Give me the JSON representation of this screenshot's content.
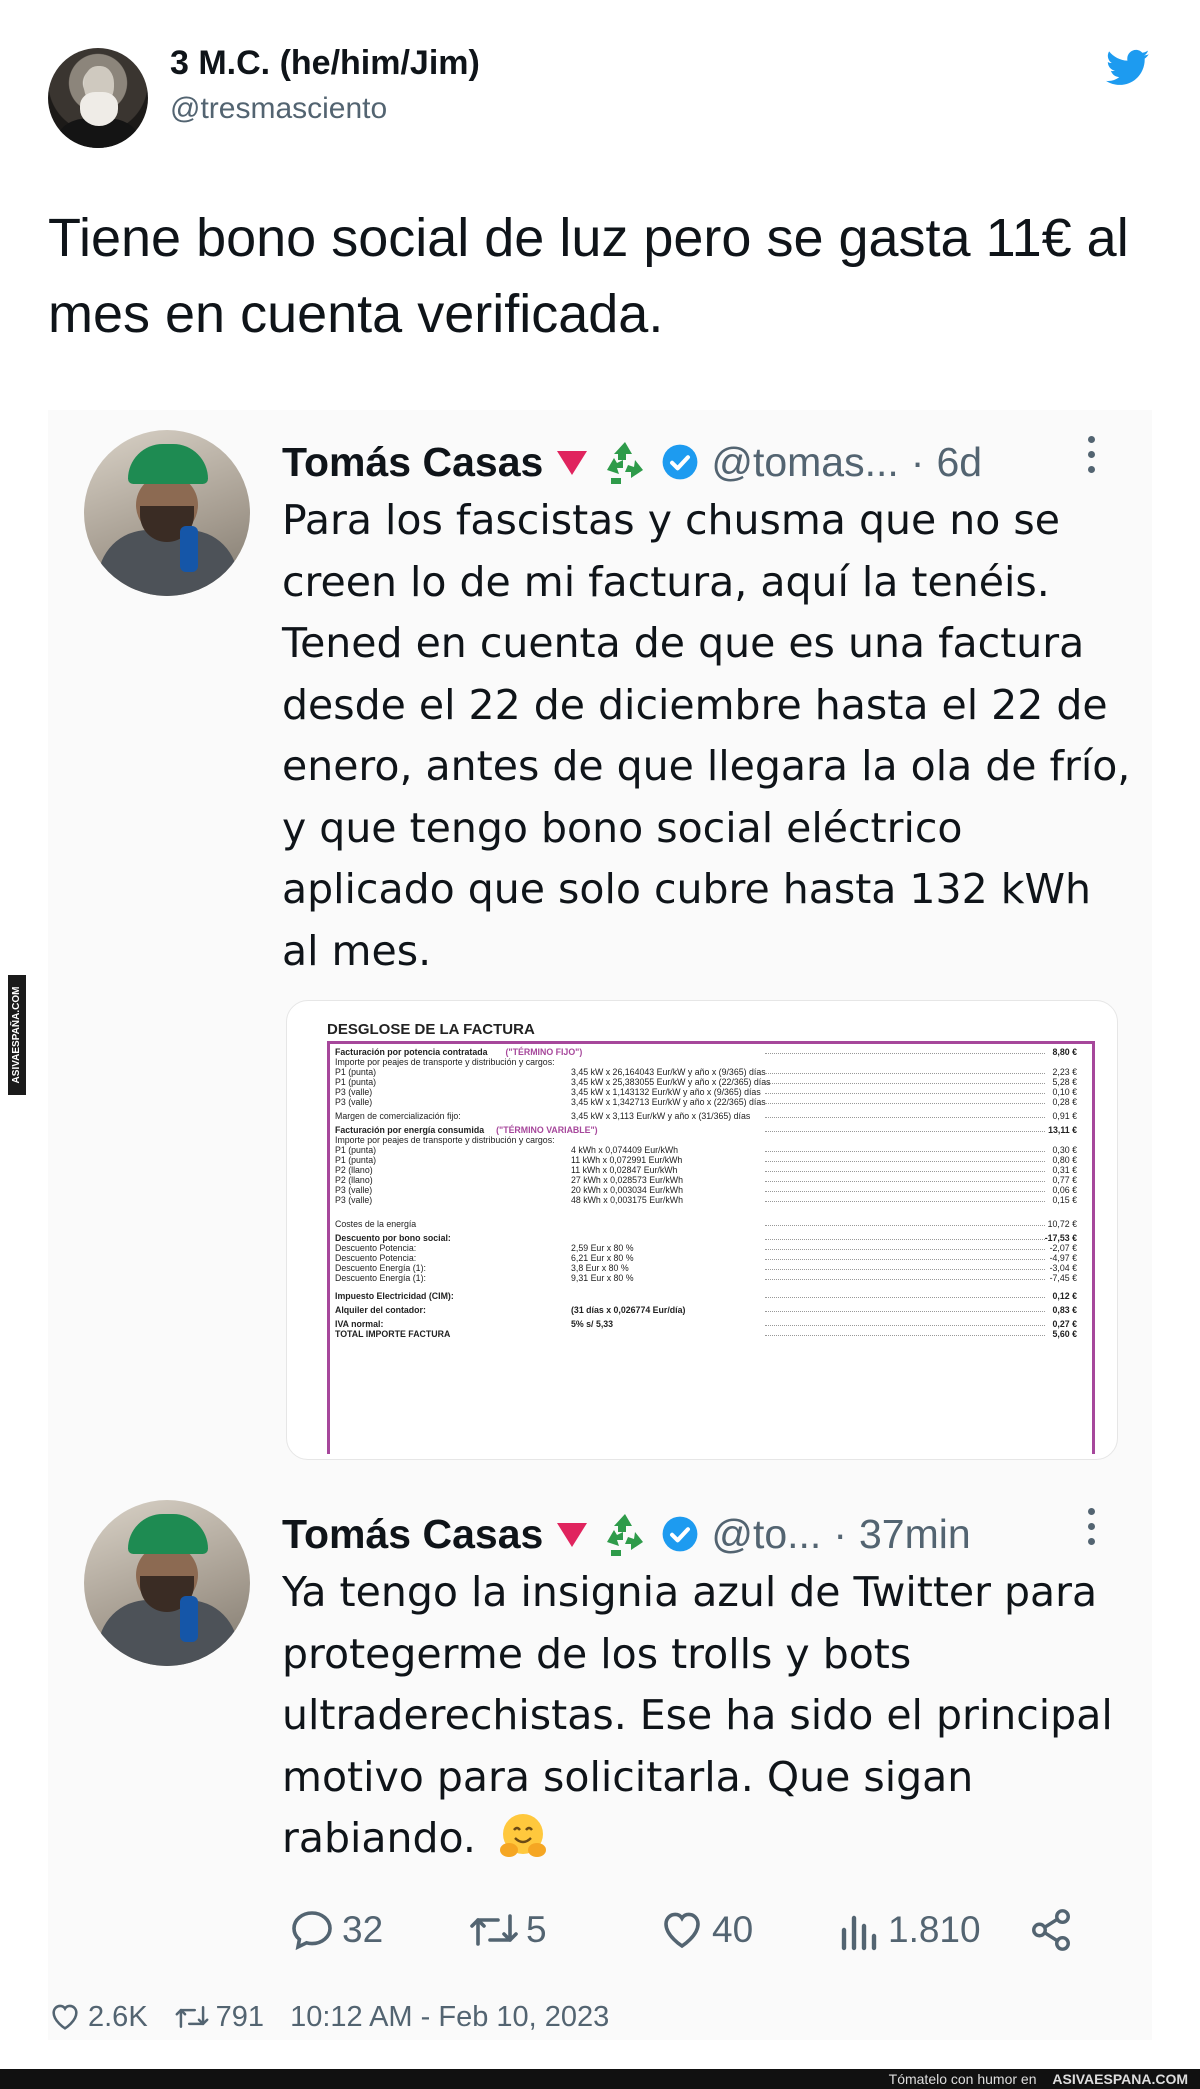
{
  "header": {
    "display_name": "3 M.C. (he/him/Jim)",
    "handle": "@tresmasciento",
    "text": "Tiene bono social de luz pero se gasta 11€ al mes en cuenta verificada."
  },
  "reply1": {
    "name": "Tomás Casas",
    "emoji_badges": [
      "▼",
      "♻"
    ],
    "handle": "@tomas...",
    "sep": "·",
    "time": "6d",
    "body": "Para los fascistas y chusma que no se creen lo de mi factura, aquí la tenéis. Tened en cuenta de que es una factura desde el 22 de diciembre hasta el 22 de enero, antes de que llegara la ola de frío, y que tengo bono social eléctrico aplicado que solo cubre hasta 132 kWh al mes."
  },
  "invoice": {
    "title": "DESGLOSE DE LA FACTURA",
    "rows": [
      {
        "c1": "Facturación por potencia contratada",
        "tag": "(\"TÉRMINO FIJO\")",
        "c2": "",
        "c3": "8,80 €",
        "bold": true
      },
      {
        "c1": "Importe por peajes de transporte y distribución y cargos:",
        "c2": "",
        "c3": ""
      },
      {
        "c1": "P1 (punta)",
        "c2": "3,45 kW x 26,164043 Eur/kW y año x (9/365) días",
        "c3": "2,23 €"
      },
      {
        "c1": "P1 (punta)",
        "c2": "3,45 kW x 25,383055 Eur/kW y año x (22/365) días",
        "c3": "5,28 €"
      },
      {
        "c1": "P3 (valle)",
        "c2": "3,45 kW x 1,143132 Eur/kW y año x (9/365) días",
        "c3": "0,10 €"
      },
      {
        "c1": "P3 (valle)",
        "c2": "3,45 kW x 1,342713 Eur/kW y año x (22/365) días",
        "c3": "0,28 €"
      },
      {
        "gap": "gap4"
      },
      {
        "c1": "Margen de comercialización fijo:",
        "c2": "3,45 kW x 3,113 Eur/kW y año x (31/365) días",
        "c3": "0,91 €"
      },
      {
        "gap": "gap4"
      },
      {
        "c1": "Facturación por energía consumida",
        "tag": "(\"TÉRMINO VARIABLE\")",
        "c2": "",
        "c3": "13,11 €",
        "bold": true
      },
      {
        "c1": "Importe por peajes de transporte y distribución y cargos:",
        "c2": "",
        "c3": ""
      },
      {
        "c1": "P1 (punta)",
        "c2": "4 kWh x 0,074409 Eur/kWh",
        "c3": "0,30 €"
      },
      {
        "c1": "P1 (punta)",
        "c2": "11 kWh x 0,072991 Eur/kWh",
        "c3": "0,80 €"
      },
      {
        "c1": "P2 (llano)",
        "c2": "11 kWh x 0,02847 Eur/kWh",
        "c3": "0,31 €"
      },
      {
        "c1": "P2 (llano)",
        "c2": "27 kWh x 0,028573 Eur/kWh",
        "c3": "0,77 €"
      },
      {
        "c1": "P3 (valle)",
        "c2": "20 kWh x 0,003034 Eur/kWh",
        "c3": "0,06 €"
      },
      {
        "c1": "P3 (valle)",
        "c2": "48 kWh x 0,003175 Eur/kWh",
        "c3": "0,15 €"
      },
      {
        "gap": "gap14"
      },
      {
        "c1": "Costes de la energía",
        "c2": "",
        "c3": "10,72 €"
      },
      {
        "gap": "gap4"
      },
      {
        "c1": "Descuento por bono social:",
        "c2": "",
        "c3": "-17,53 €",
        "bold": true
      },
      {
        "c1": "Descuento Potencia:",
        "c2": "2,59 Eur x 80 %",
        "c3": "-2,07 €"
      },
      {
        "c1": "Descuento Potencia:",
        "c2": "6,21 Eur x 80 %",
        "c3": "-4,97 €"
      },
      {
        "c1": "Descuento Energía (1):",
        "c2": "3,8 Eur x 80 %",
        "c3": "-3,04 €"
      },
      {
        "c1": "Descuento Energía (1):",
        "c2": "9,31 Eur x 80 %",
        "c3": "-7,45 €"
      },
      {
        "gap": "gap8"
      },
      {
        "c1": "Impuesto Electricidad (CIM):",
        "c2": "",
        "c3": "0,12 €",
        "bold": true
      },
      {
        "gap": "gap4"
      },
      {
        "c1": "Alquiler del contador:",
        "c2": "(31 días x 0,026774 Eur/día)",
        "c3": "0,83 €",
        "bold": true
      },
      {
        "gap": "gap4"
      },
      {
        "c1": "IVA normal:",
        "c2": "5%   s/ 5,33",
        "c3": "0,27 €",
        "bold": true
      },
      {
        "c1": "TOTAL IMPORTE FACTURA",
        "c2": "",
        "c3": "5,60 €",
        "bold": true
      }
    ]
  },
  "reply2": {
    "name": "Tomás Casas",
    "handle": "@to...",
    "sep": "·",
    "time": "37min",
    "body": "Ya tengo la insignia azul de Twitter para protegerme de los trolls y bots ultraderechistas. Ese ha sido el principal motivo para solicitarla. Que sigan rabiando."
  },
  "actions": {
    "replies": "32",
    "retweets": "5",
    "likes": "40",
    "views": "1.810"
  },
  "footer": {
    "likes": "2.6K",
    "retweets": "791",
    "timestamp": "10:12 AM - Feb 10, 2023"
  },
  "watermark": {
    "side": "ASIVAESPAÑA.COM",
    "bottom_prefix": "Tómatelo con humor en",
    "bottom_site": "ASIVAESPANA.COM"
  },
  "colors": {
    "twitter_blue": "#1d9bf0",
    "invoice_purple": "#a6479b",
    "text_gray": "#536471"
  }
}
